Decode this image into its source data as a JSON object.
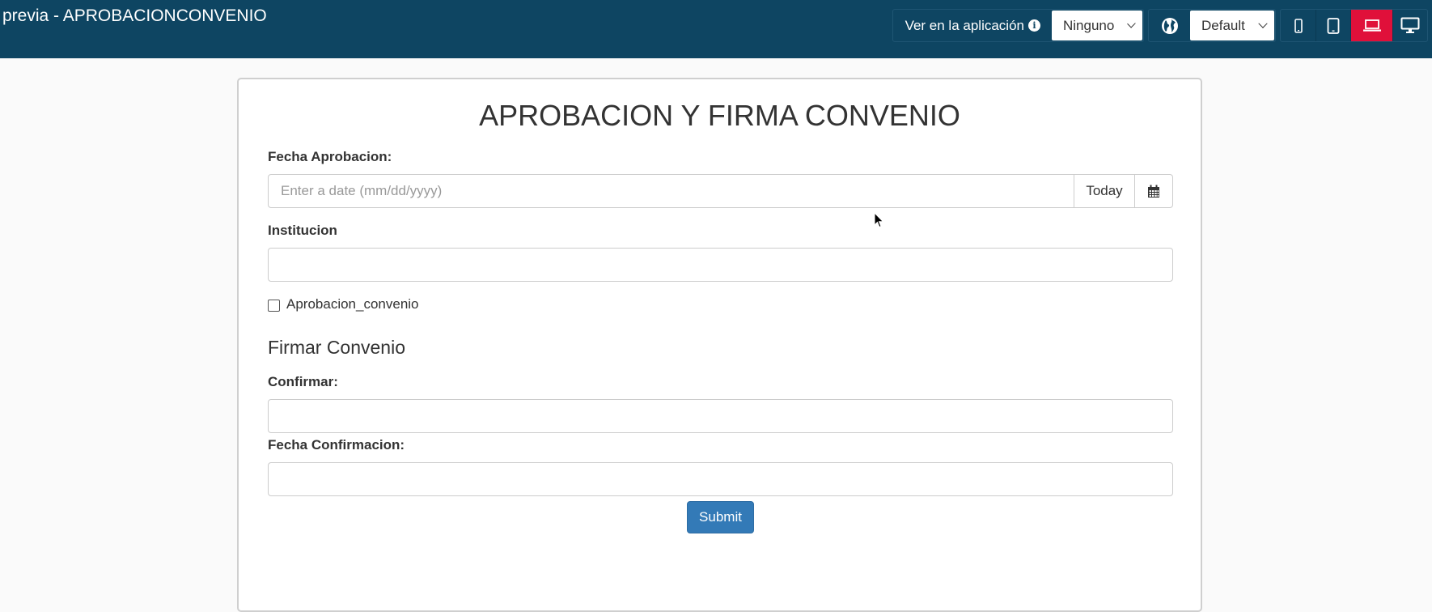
{
  "window": {
    "title": "previa - APROBACIONCONVENIO"
  },
  "toolbar": {
    "view_in_app_label": "Ver en la aplicación",
    "view_in_app_select": "Ninguno",
    "language_select": "Default",
    "active_device": "laptop",
    "accent_color": "#e0103a",
    "bar_color": "#0e4562"
  },
  "form": {
    "title": "APROBACION Y FIRMA CONVENIO",
    "fecha_aprobacion": {
      "label": "Fecha Aprobacion:",
      "placeholder": "Enter a date (mm/dd/yyyy)",
      "today_label": "Today"
    },
    "institucion": {
      "label": "Institucion",
      "value": ""
    },
    "aprobacion_convenio": {
      "label": "Aprobacion_convenio",
      "checked": false
    },
    "section_title": "Firmar Convenio",
    "confirmar": {
      "label": "Confirmar:",
      "value": ""
    },
    "fecha_confirmacion": {
      "label": "Fecha Confirmacion:",
      "value": ""
    },
    "submit_label": "Submit",
    "submit_color": "#337ab7"
  }
}
